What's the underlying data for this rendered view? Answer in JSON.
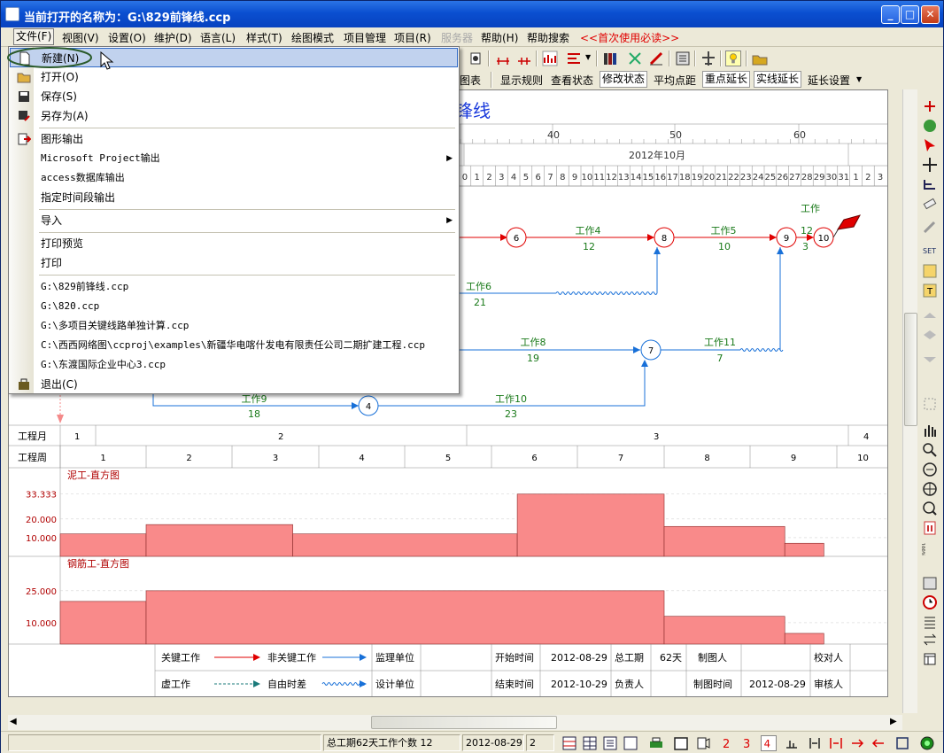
{
  "window": {
    "title": "当前打开的名称为：G:\\829前锋线.ccp",
    "min": "_",
    "max": "□",
    "close": "✕"
  },
  "menubar": [
    "文件(F)",
    "视图(V)",
    "设置(O)",
    "维护(D)",
    "语言(L)",
    "样式(T)",
    "绘图模式",
    "项目管理",
    "项目(R)",
    "服务器",
    "帮助(H)",
    "帮助搜索",
    "<<首次使用必读>>"
  ],
  "toolbar2": [
    "图表",
    "显示规则",
    "查看状态",
    "修改状态",
    "平均点距",
    "重点延长",
    "实线延长",
    "延长设置"
  ],
  "file_menu": {
    "items": [
      "新建(N)",
      "打开(O)",
      "保存(S)",
      "另存为(A)",
      "图形输出",
      "Microsoft Project输出",
      "access数据库输出",
      "指定时间段输出",
      "导入",
      "打印预览",
      "打印"
    ],
    "recent": [
      "G:\\829前锋线.ccp",
      "G:\\820.ccp",
      "G:\\多项目关键线路单独计算.ccp",
      "C:\\西西网络图\\ccproj\\examples\\新疆华电喀什发电有限责任公司二期扩建工程.ccp",
      "G:\\东渡国际企业中心3.ccp"
    ],
    "exit": "退出(C)"
  },
  "chart": {
    "title_fragment": "锋线",
    "scale_ticks": [
      "40",
      "50",
      "60"
    ],
    "month_label": "2012年10月",
    "days": [
      "0",
      "1",
      "2",
      "3",
      "4",
      "5",
      "6",
      "7",
      "8",
      "9",
      "10",
      "11",
      "12",
      "13",
      "14",
      "15",
      "16",
      "17",
      "18",
      "19",
      "20",
      "21",
      "22",
      "23",
      "24",
      "25",
      "26",
      "27",
      "28",
      "29",
      "30",
      "31",
      "1",
      "2",
      "3"
    ],
    "nodes": [
      "6",
      "8",
      "9",
      "10",
      "7",
      "4"
    ],
    "tasks": [
      {
        "name": "工作4",
        "dur": "12"
      },
      {
        "name": "工作5",
        "dur": "10"
      },
      {
        "name": "工作",
        "dur": "12"
      },
      {
        "name": "工作6",
        "dur": "21"
      },
      {
        "name": "工作8",
        "dur": "19"
      },
      {
        "name": "工作11",
        "dur": "7"
      },
      {
        "name": "工作9",
        "dur": "18"
      },
      {
        "name": "工作10",
        "dur": "23"
      }
    ],
    "extra_dur": "3",
    "month_row_label": "工程月",
    "months": [
      "1",
      "2",
      "3",
      "4"
    ],
    "week_row_label": "工程周",
    "weeks": [
      "1",
      "2",
      "3",
      "4",
      "5",
      "6",
      "7",
      "8",
      "9",
      "10"
    ]
  },
  "chart_data": [
    {
      "type": "bar",
      "title": "泥工-直方图",
      "y_ticks": [
        "33.333",
        "20.000",
        "10.000"
      ],
      "segments_weeks": [
        [
          0,
          1,
          12
        ],
        [
          1,
          2.7,
          17
        ],
        [
          2.7,
          5.3,
          12
        ],
        [
          5.3,
          7,
          33.333
        ],
        [
          7,
          8.4,
          16
        ],
        [
          8.4,
          8.85,
          7
        ]
      ]
    },
    {
      "type": "bar",
      "title": "钢筋工-直方图",
      "y_ticks": [
        "25.000",
        "10.000"
      ],
      "segments_weeks": [
        [
          0,
          1,
          20
        ],
        [
          1,
          7,
          25
        ],
        [
          7,
          8.4,
          13
        ],
        [
          8.4,
          8.85,
          5
        ]
      ]
    }
  ],
  "legend": {
    "critical": "关键工作",
    "noncritical": "非关键工作",
    "dummy": "虚工作",
    "float": "自由时差",
    "supervisor": "监理单位",
    "designer": "设计单位",
    "start_label": "开始时间",
    "start": "2012-08-29",
    "end_label": "结束时间",
    "end": "2012-10-29",
    "total_label": "总工期",
    "total": "62天",
    "owner_label": "负责人",
    "drawer_label": "制图人",
    "drawtime_label": "制图时间",
    "drawtime": "2012-08-29",
    "checker_label": "校对人",
    "reviewer_label": "审核人"
  },
  "status": {
    "summary": "总工期62天工作个数 12",
    "date": "2012-08-29",
    "page": "2"
  },
  "colors": {
    "critical": "#e00000",
    "noncritical": "#1870d8",
    "histogram": "#f98a8a",
    "label_green": "#1a7a1a"
  }
}
